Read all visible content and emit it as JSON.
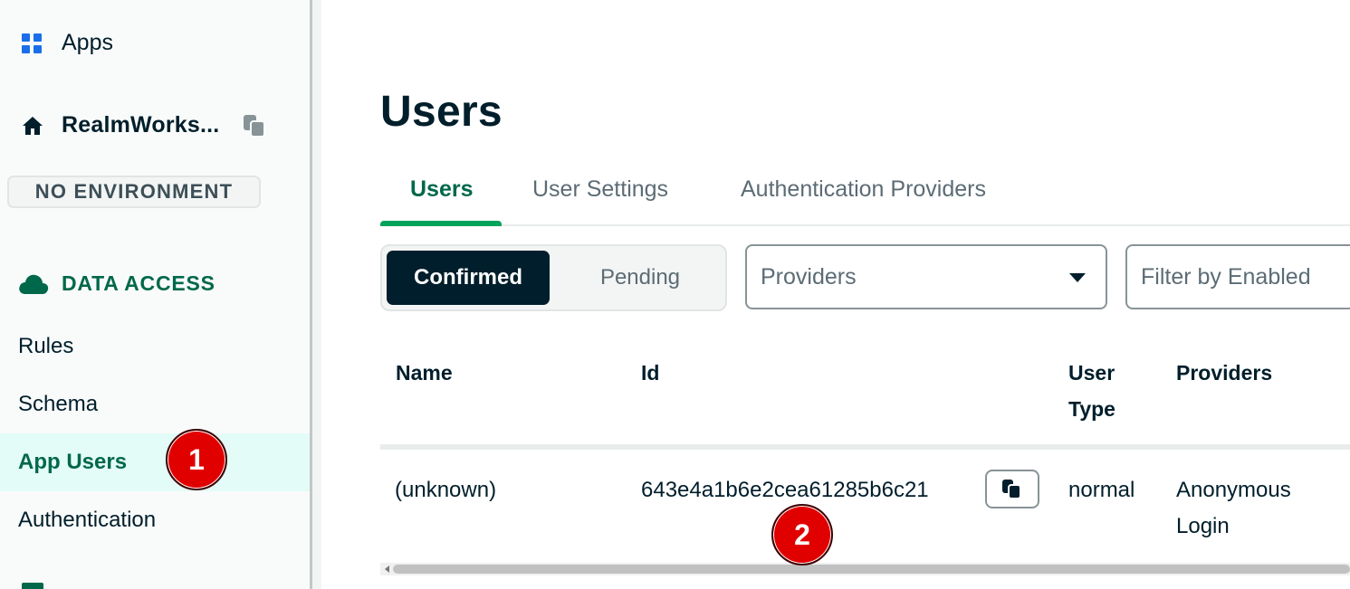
{
  "sidebar": {
    "apps_label": "Apps",
    "project_name": "RealmWorks...",
    "environment": "NO ENVIRONMENT",
    "section_title": "DATA ACCESS",
    "items": [
      {
        "label": "Rules"
      },
      {
        "label": "Schema"
      },
      {
        "label": "App Users",
        "active": true
      },
      {
        "label": "Authentication"
      }
    ]
  },
  "main": {
    "title": "Users",
    "tabs": [
      {
        "label": "Users",
        "active": true
      },
      {
        "label": "User Settings"
      },
      {
        "label": "Authentication Providers"
      }
    ],
    "segmented": {
      "confirmed": "Confirmed",
      "pending": "Pending",
      "selected": "Confirmed"
    },
    "providers_select": {
      "value": "Providers"
    },
    "enabled_filter": {
      "value": "Filter by Enabled"
    },
    "table": {
      "headers": {
        "name": "Name",
        "id": "Id",
        "user_type_1": "User",
        "user_type_2": "Type",
        "providers": "Providers"
      },
      "rows": [
        {
          "name": "(unknown)",
          "id": "643e4a1b6e2cea61285b6c21",
          "user_type": "normal",
          "providers_1": "Anonymous",
          "providers_2": "Login"
        }
      ]
    }
  },
  "annotations": {
    "step1": "1",
    "step2": "2"
  },
  "colors": {
    "accent_green": "#00684a",
    "tab_underline": "#00a35c",
    "active_bg": "#e3fcf7",
    "dark": "#001e2b",
    "marker_red": "#e10000"
  },
  "icons": {
    "apps": "grid-icon",
    "project": "home-icon",
    "copy": "copy-icon",
    "section": "cloud-icon",
    "dropdown": "caret-down-icon"
  }
}
